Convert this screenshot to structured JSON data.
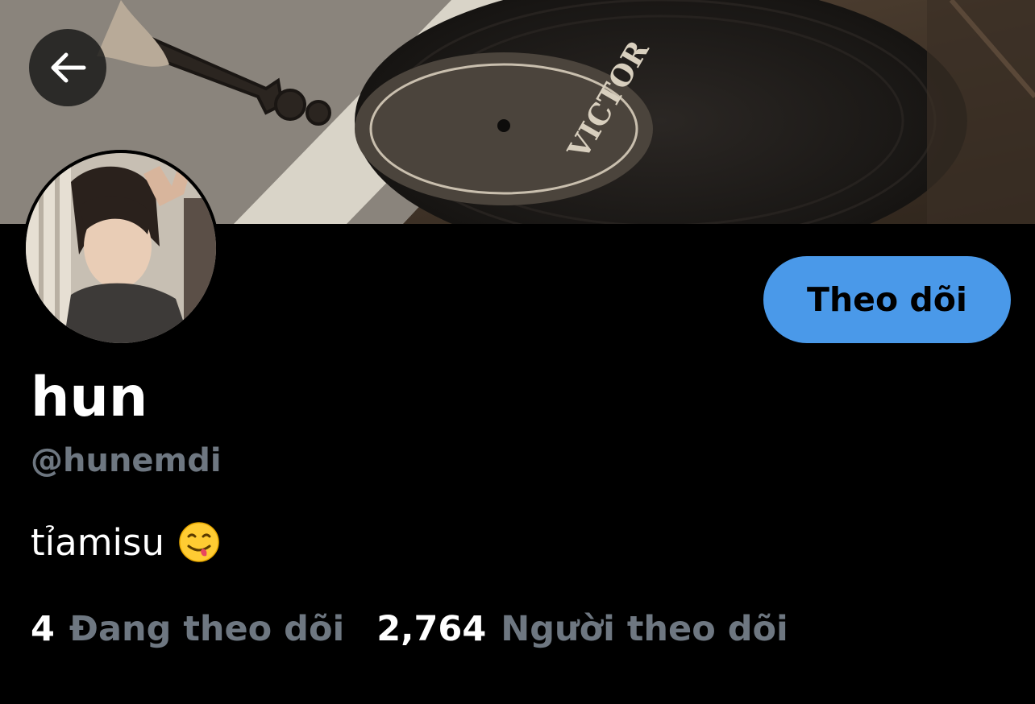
{
  "header": {
    "back_icon": "arrow-left-icon",
    "banner_text": "VICTOR"
  },
  "profile": {
    "display_name": "hun",
    "handle": "@hunemdi",
    "bio_text": "tỉamisu",
    "bio_emoji": "face-savoring-food-emoji",
    "follow_label": "Theo dõi"
  },
  "stats": {
    "following_count": "4",
    "following_label": "Đang theo dõi",
    "followers_count": "2,764",
    "followers_label": "Người theo dõi"
  },
  "colors": {
    "background": "#000000",
    "accent": "#4a99e9",
    "secondary_text": "#6e7781",
    "primary_text": "#ffffff"
  }
}
